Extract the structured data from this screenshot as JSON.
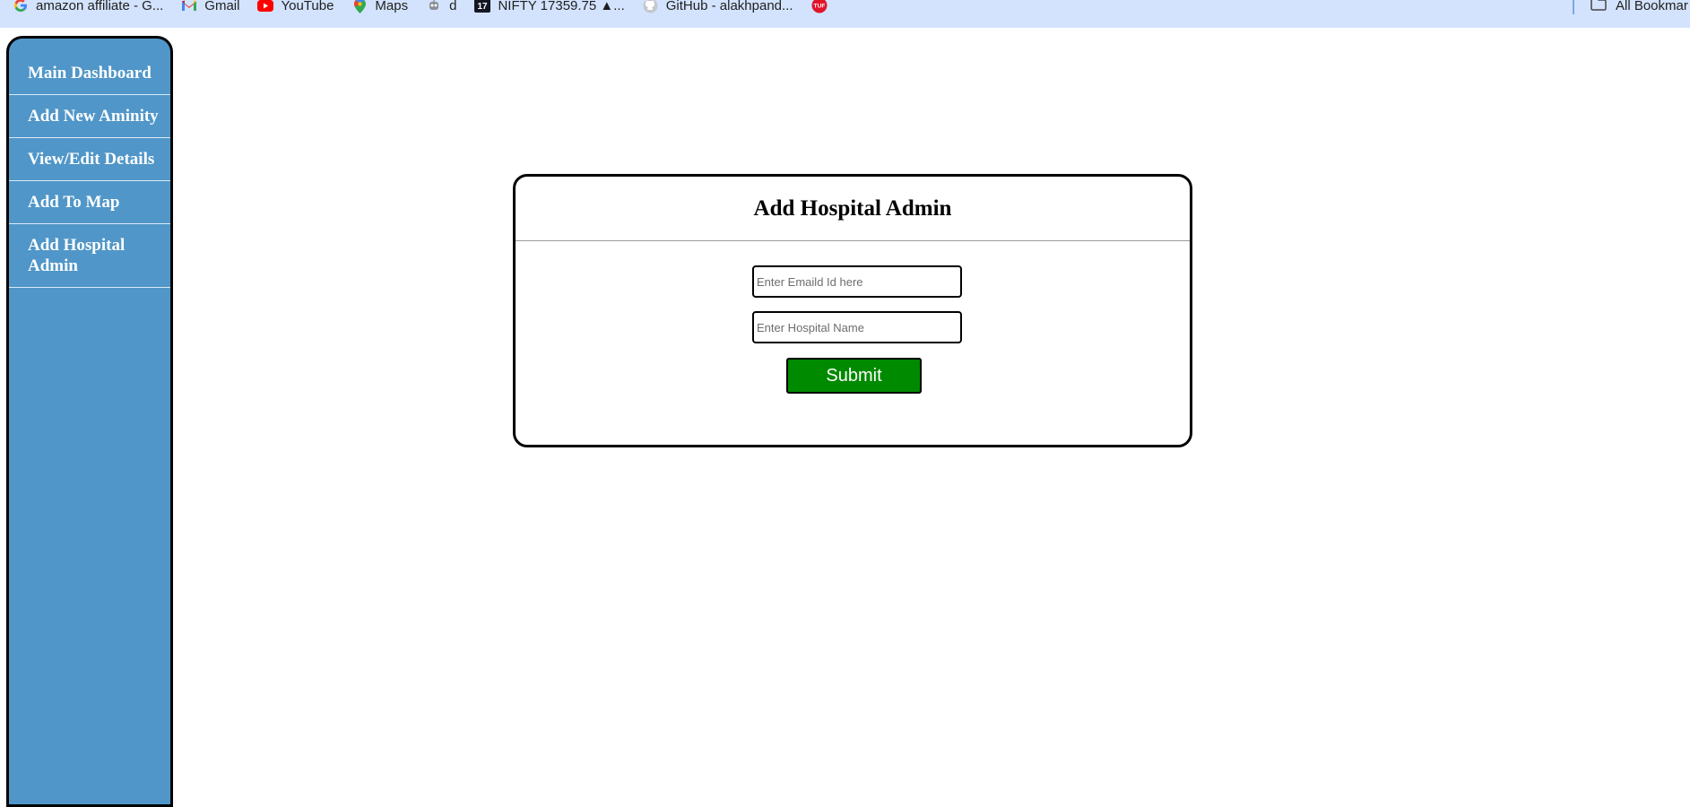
{
  "bookmarks": [
    {
      "icon": "google-icon",
      "label": "amazon affiliate - G..."
    },
    {
      "icon": "gmail-icon",
      "label": "Gmail"
    },
    {
      "icon": "youtube-icon",
      "label": "YouTube"
    },
    {
      "icon": "maps-icon",
      "label": "Maps"
    },
    {
      "icon": "robot-icon",
      "label": "d"
    },
    {
      "icon": "tradingview-icon",
      "label": "NIFTY 17359.75 ▲..."
    },
    {
      "icon": "github-icon",
      "label": "GitHub - alakhpand..."
    },
    {
      "icon": "tuf-icon",
      "label": ""
    }
  ],
  "bookmarks_right": {
    "icon": "folder-icon",
    "label": "All Bookmar"
  },
  "sidebar": {
    "items": [
      {
        "label": "Main Dashboard"
      },
      {
        "label": "Add New Aminity"
      },
      {
        "label": "View/Edit Details"
      },
      {
        "label": "Add To Map"
      },
      {
        "label": "Add Hospital Admin"
      }
    ]
  },
  "form": {
    "title": "Add Hospital Admin",
    "email_placeholder": "Enter Emaild Id here",
    "email_value": "",
    "hospital_placeholder": "Enter Hospital Name",
    "hospital_value": "",
    "submit_label": "Submit"
  },
  "colors": {
    "bookmarks_bar": "#d3e3fd",
    "sidebar": "#5096c8",
    "submit": "#008a00"
  }
}
